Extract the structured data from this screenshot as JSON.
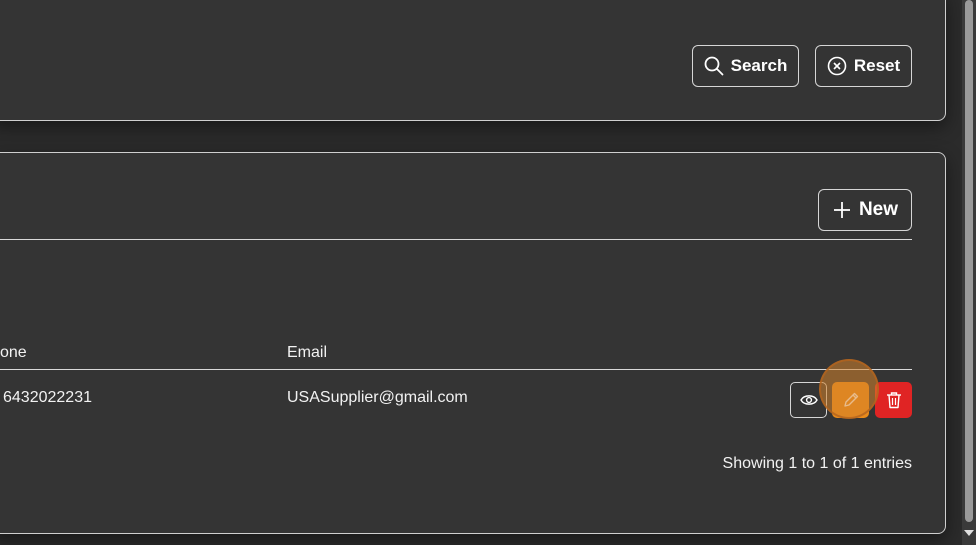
{
  "filters": {
    "search_label": "Search",
    "reset_label": "Reset"
  },
  "list": {
    "new_label": "New",
    "columns": [
      "one",
      "Email"
    ],
    "rows": [
      {
        "phone": "6432022231",
        "email": "USASupplier@gmail.com"
      }
    ],
    "showing": "Showing 1 to 1 of 1 entries"
  },
  "colors": {
    "edit": "#e88a1a",
    "delete": "#e02424",
    "background": "#343434"
  },
  "icons": [
    "search-icon",
    "reset-x-circle-icon",
    "plus-icon",
    "eye-icon",
    "pencil-icon",
    "trash-icon"
  ]
}
